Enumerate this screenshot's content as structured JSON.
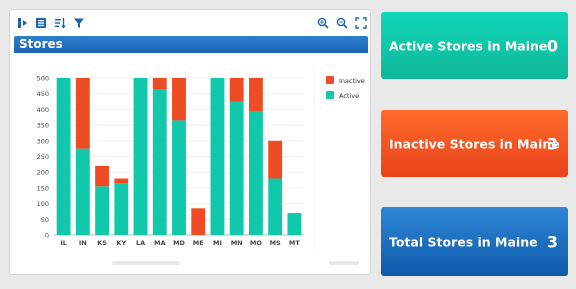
{
  "toolbar": {
    "icons": [
      "export-icon",
      "grid-icon",
      "sort-icon",
      "filter-icon",
      "zoom-in-icon",
      "zoom-out-icon",
      "fullscreen-icon"
    ]
  },
  "chart_title": "Stores",
  "colors": {
    "active": "#12c8ab",
    "inactive": "#ed4c24",
    "accent": "#1a63b4"
  },
  "chart_data": {
    "type": "bar",
    "stacked": true,
    "categories": [
      "IL",
      "IN",
      "KS",
      "KY",
      "LA",
      "MA",
      "MD",
      "ME",
      "MI",
      "MN",
      "MO",
      "MS",
      "MT"
    ],
    "series": [
      {
        "name": "Active",
        "values": [
          500,
          275,
          155,
          165,
          500,
          465,
          365,
          0,
          500,
          425,
          395,
          180,
          70
        ]
      },
      {
        "name": "Inactive",
        "values": [
          0,
          225,
          65,
          15,
          0,
          35,
          135,
          85,
          0,
          75,
          105,
          120,
          0
        ]
      }
    ],
    "ylim": [
      0,
      500
    ],
    "yticks": [
      0,
      50,
      100,
      150,
      200,
      250,
      300,
      350,
      400,
      450,
      500
    ],
    "legend": [
      "Inactive",
      "Active"
    ],
    "legend_position": "top-right",
    "grid": true
  },
  "kpis": [
    {
      "label": "Active Stores in Maine",
      "value": "0"
    },
    {
      "label": "Inactive Stores in Maine",
      "value": "3"
    },
    {
      "label": "Total Stores in Maine",
      "value": "3"
    }
  ]
}
